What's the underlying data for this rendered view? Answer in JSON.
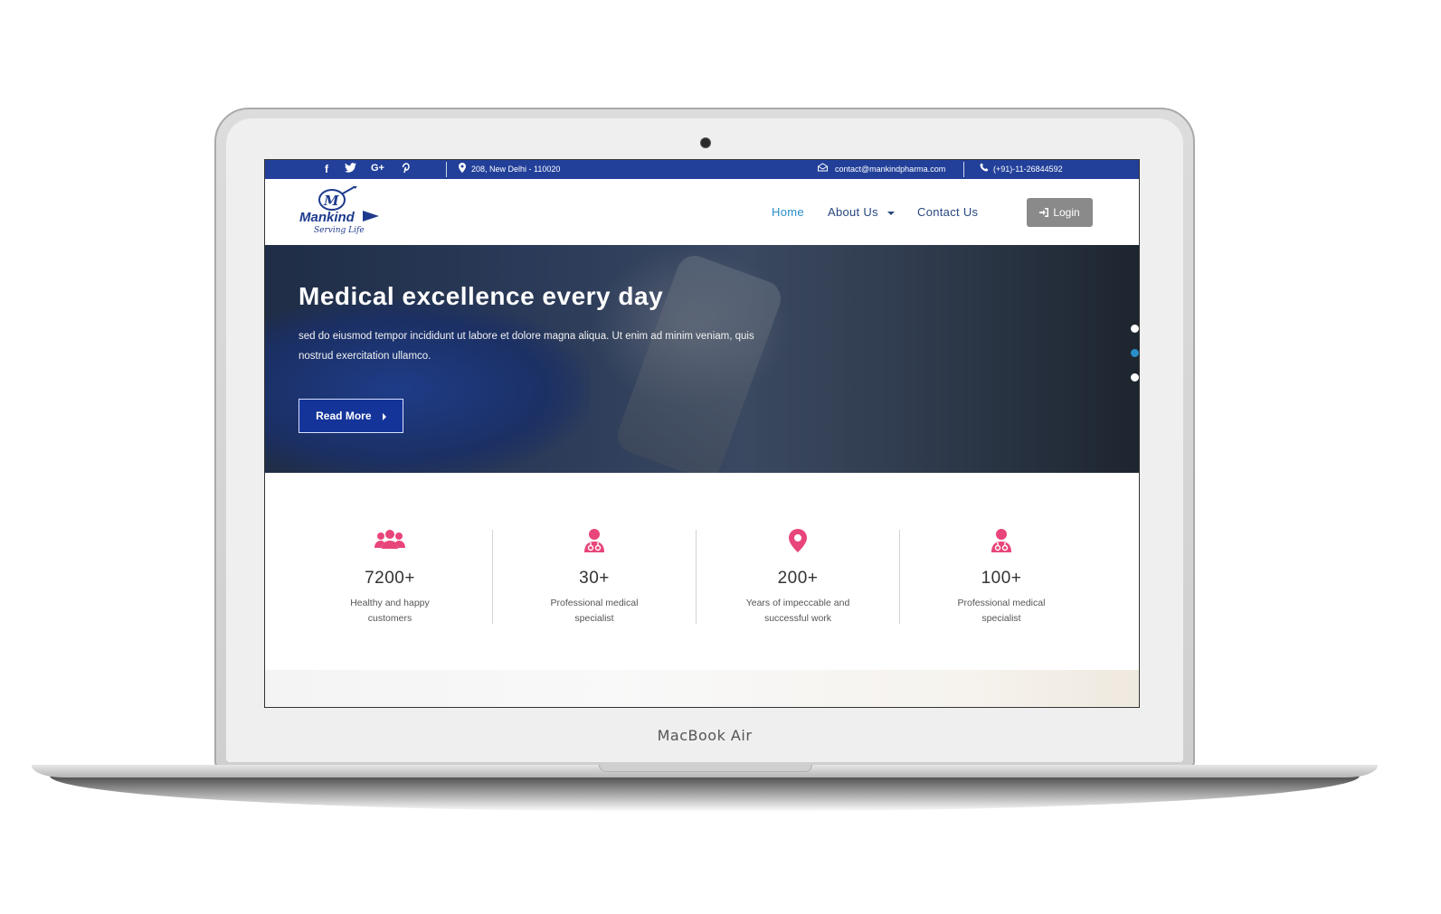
{
  "device": {
    "label": "MacBook Air"
  },
  "topbar": {
    "social_icons": [
      "facebook-icon",
      "twitter-icon",
      "google-plus-icon",
      "pinterest-icon"
    ],
    "address": "208, New Delhi - 110020",
    "email": "contact@mankindpharma.com",
    "phone": "(+91)-11-26844592"
  },
  "logo": {
    "name": "Mankind",
    "tagline": "Serving Life"
  },
  "nav": {
    "items": [
      {
        "label": "Home",
        "active": true
      },
      {
        "label": "About Us",
        "dropdown": true
      },
      {
        "label": "Contact Us"
      }
    ],
    "login_label": "Login"
  },
  "hero": {
    "title": "Medical excellence every day",
    "description": "sed do eiusmod tempor incididunt ut labore et dolore magna aliqua. Ut enim ad minim veniam, quis nostrud exercitation ullamco.",
    "button_label": "Read More",
    "slides": 3,
    "active_slide": 2
  },
  "stats": [
    {
      "icon": "users-icon",
      "value": "7200+",
      "label": "Healthy and happy customers"
    },
    {
      "icon": "doctor-icon",
      "value": "30+",
      "label": "Professional medical specialist"
    },
    {
      "icon": "map-marker-icon",
      "value": "200+",
      "label": "Years of impeccable and successful work"
    },
    {
      "icon": "doctor-icon",
      "value": "100+",
      "label": "Professional medical specialist"
    }
  ],
  "colors": {
    "primary": "#22409a",
    "accent": "#e8457a",
    "link": "#2a8fc9",
    "login": "#8a8a8a"
  }
}
